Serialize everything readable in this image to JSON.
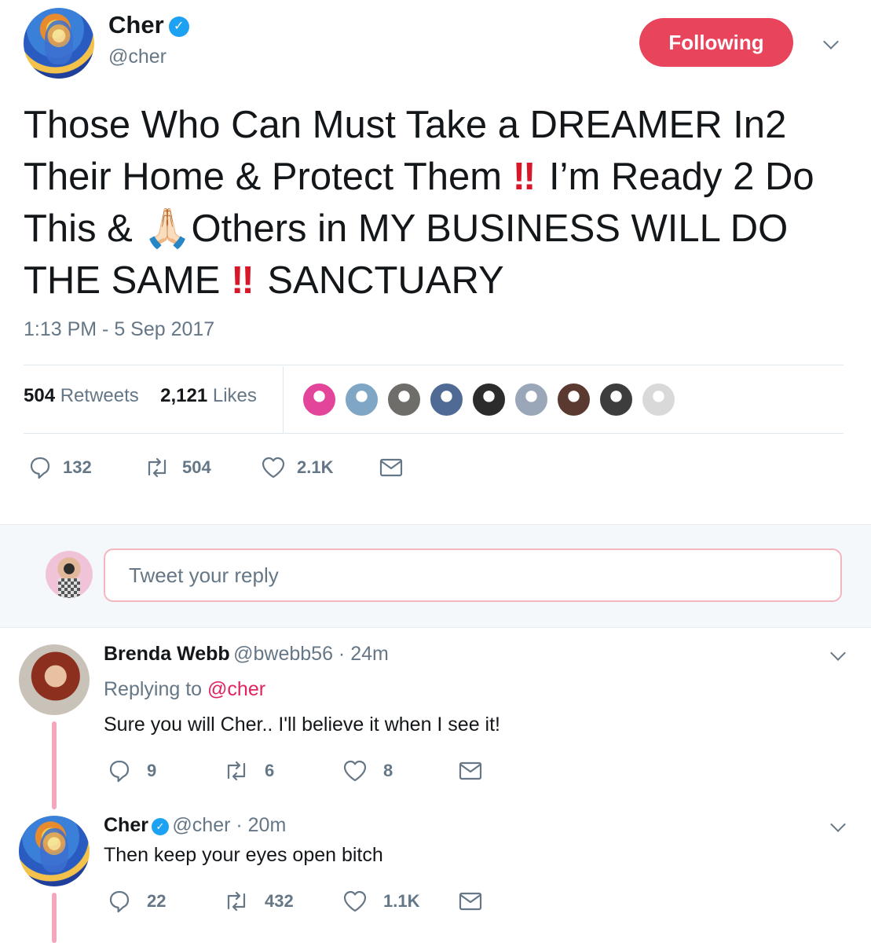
{
  "tweet": {
    "author": {
      "name": "Cher",
      "handle": "@cher",
      "verified": true,
      "follow_button": "Following"
    },
    "text_parts": [
      "Those Who Can Must Take a DREAMER In2 Their Home & Protect Them",
      "‼",
      " I’m Ready 2 Do This & ",
      "🙏🏻",
      "Others in MY BUSINESS WILL DO THE SAME",
      "‼",
      " SANCTUARY"
    ],
    "timestamp": "1:13 PM - 5 Sep 2017",
    "stats": {
      "retweets_count": "504",
      "retweets_label": "Retweets",
      "likes_count": "2,121",
      "likes_label": "Likes"
    },
    "actions": {
      "replies": "132",
      "retweets": "504",
      "likes": "2.1K"
    },
    "liker_avatar_colors": [
      "#e2459a",
      "#7fa6c4",
      "#6f6d6a",
      "#4f6b95",
      "#2c2c2c",
      "#9aa7b8",
      "#5a3a30",
      "#3d3d3d",
      "#d9d9d9"
    ]
  },
  "reply_box": {
    "placeholder": "Tweet your reply"
  },
  "replies": [
    {
      "name": "Brenda Webb",
      "handle": "@bwebb56",
      "time": "24m",
      "replying_to_label": "Replying to",
      "replying_to": "@cher",
      "text": "Sure you will Cher.. I'll believe it when I see it!",
      "replies": "9",
      "retweets": "6",
      "likes": "8"
    },
    {
      "name": "Cher",
      "handle": "@cher",
      "verified": true,
      "time": "20m",
      "text": "Then keep your eyes open bitch",
      "replies": "22",
      "retweets": "432",
      "likes": "1.1K"
    }
  ],
  "colors": {
    "accent": "#e8455d",
    "verified": "#1da1f2",
    "mention": "#e0245e",
    "secondary_text": "#657786"
  }
}
